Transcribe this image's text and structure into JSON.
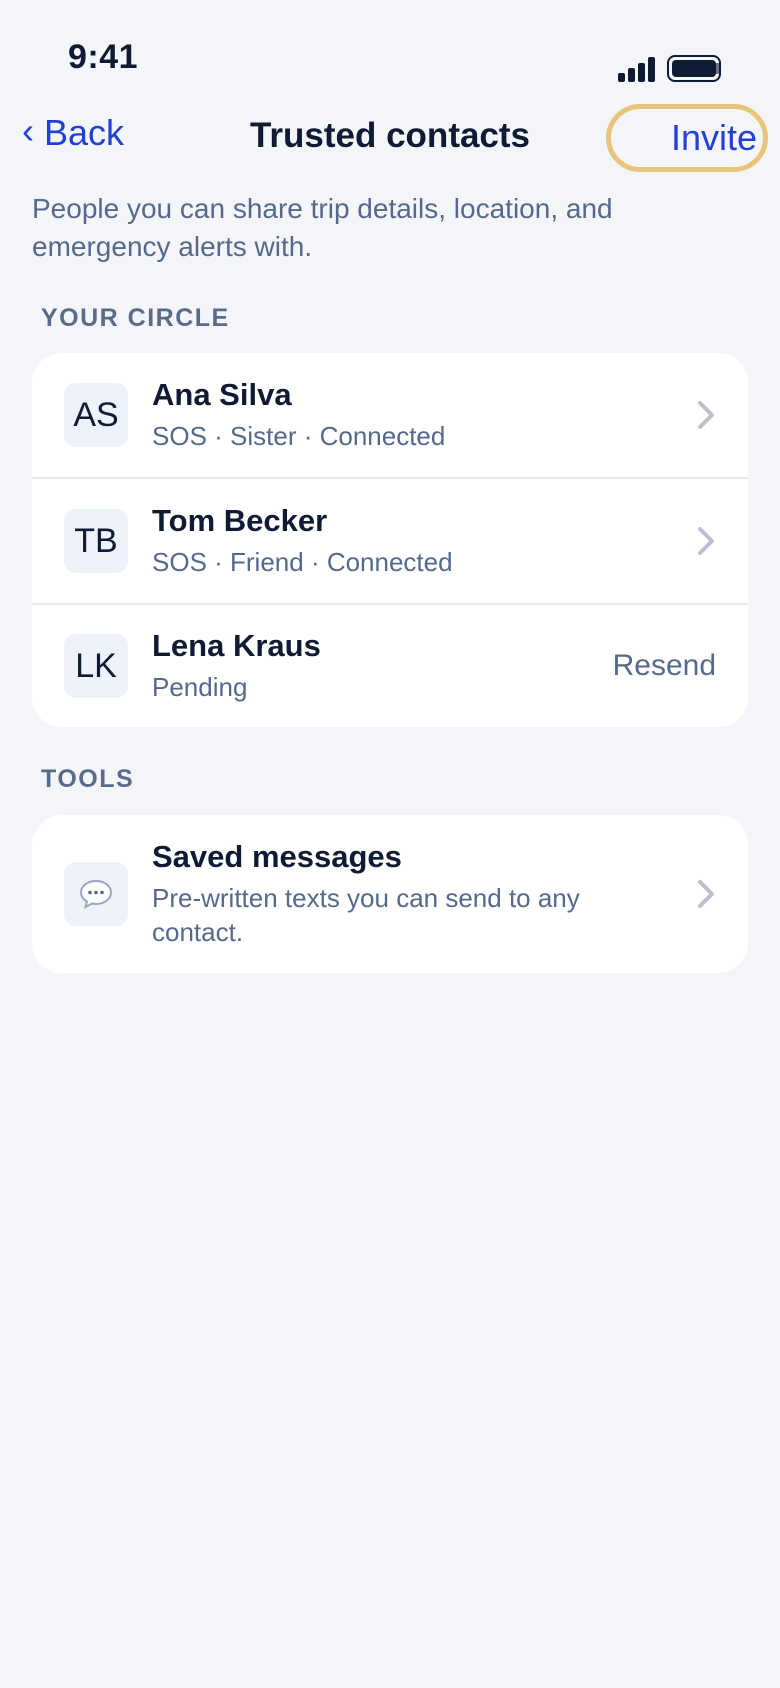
{
  "status_bar": {
    "time": "9:41"
  },
  "nav": {
    "back_label": "Back",
    "title": "Trusted contacts",
    "invite_label": "Invite"
  },
  "intro_text": "People you can share trip details, location, and emergency alerts with.",
  "circle": {
    "header": "YOUR CIRCLE",
    "contacts": [
      {
        "initials": "AS",
        "name": "Ana Silva",
        "subtitle": "SOS · Sister · Connected"
      },
      {
        "initials": "TB",
        "name": "Tom Becker",
        "subtitle": "SOS · Friend · Connected"
      },
      {
        "initials": "LK",
        "name": "Lena Kraus",
        "subtitle": "Pending",
        "action": "Resend"
      }
    ]
  },
  "tools": {
    "header": "TOOLS",
    "items": [
      {
        "icon": "speech-bubble-icon",
        "title": "Saved messages",
        "subtitle": "Pre-written texts you can send to any contact."
      }
    ]
  },
  "colors": {
    "accent": "#2340d6",
    "highlight_ring": "#e8c57a",
    "background": "#f3f5f9",
    "text_primary": "#0f1a33",
    "text_secondary": "#56698c"
  }
}
